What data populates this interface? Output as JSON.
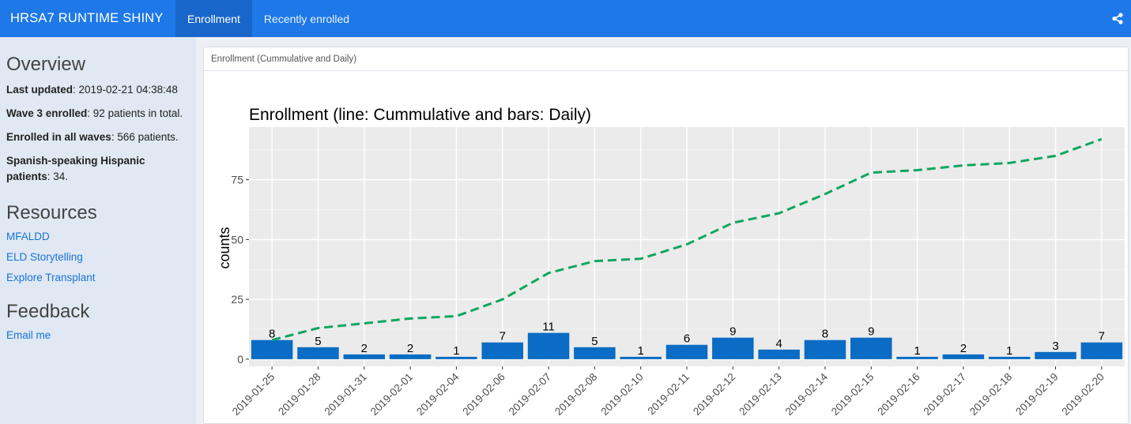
{
  "navbar": {
    "brand": "HRSA7 RUNTIME SHINY",
    "tabs": [
      "Enrollment",
      "Recently enrolled"
    ],
    "active_tab": "Enrollment",
    "share_icon": "share-icon"
  },
  "sidebar": {
    "overview_title": "Overview",
    "stats": [
      {
        "label": "Last updated",
        "value": ": 2019-02-21 04:38:48"
      },
      {
        "label": "Wave 3 enrolled",
        "value": ": 92 patients in total."
      },
      {
        "label": "Enrolled in all waves",
        "value": ": 566 patients."
      },
      {
        "label": "Spanish-speaking Hispanic patients",
        "value": ": 34."
      }
    ],
    "resources_title": "Resources",
    "resources": [
      "MFALDD",
      "ELD Storytelling",
      "Explore Transplant"
    ],
    "feedback_title": "Feedback",
    "feedback_link": "Email me"
  },
  "panel": {
    "heading": "Enrollment (Cummulative and Daily)"
  },
  "colors": {
    "navbar": "#1e78e8",
    "active_tab": "#1866c9",
    "bar": "#0a6cc4",
    "line": "#0fa660",
    "plot_bg": "#ebebeb"
  },
  "chart_data": {
    "type": "bar",
    "title": "Enrollment (line: Cummulative and bars: Daily)",
    "ylabel": "counts",
    "xlabel": "",
    "categories": [
      "2019-01-25",
      "2019-01-28",
      "2019-01-31",
      "2019-02-01",
      "2019-02-04",
      "2019-02-06",
      "2019-02-07",
      "2019-02-08",
      "2019-02-10",
      "2019-02-11",
      "2019-02-12",
      "2019-02-13",
      "2019-02-14",
      "2019-02-15",
      "2019-02-16",
      "2019-02-17",
      "2019-02-18",
      "2019-02-19",
      "2019-02-20"
    ],
    "series": [
      {
        "type": "bar",
        "values": [
          8,
          5,
          2,
          2,
          1,
          7,
          11,
          5,
          1,
          6,
          9,
          4,
          8,
          9,
          1,
          2,
          1,
          3,
          7
        ]
      },
      {
        "type": "line",
        "style": "dashed",
        "values": [
          8,
          13,
          15,
          17,
          18,
          25,
          36,
          41,
          42,
          48,
          57,
          61,
          69,
          78,
          79,
          81,
          82,
          85,
          92
        ]
      }
    ],
    "ylim": [
      -3,
      97
    ],
    "yticks": [
      0,
      25,
      50,
      75
    ],
    "grid": true
  }
}
